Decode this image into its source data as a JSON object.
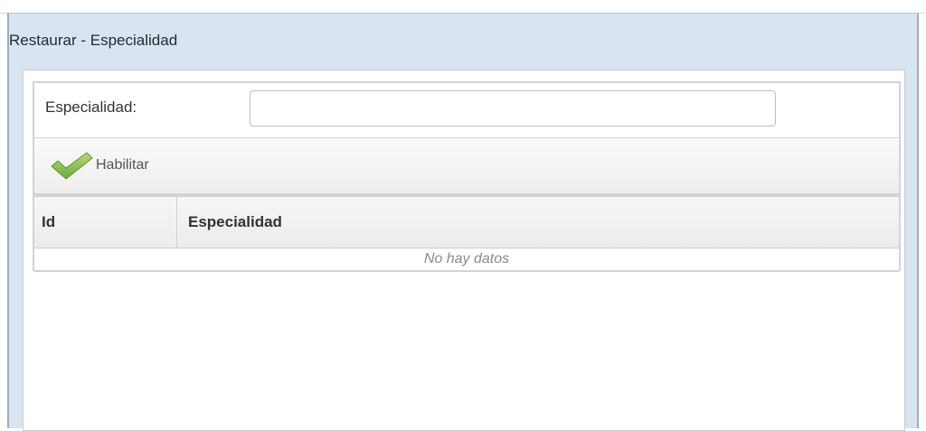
{
  "window": {
    "title": "Restaurar - Especialidad"
  },
  "form": {
    "label": "Especialidad:",
    "value": "",
    "placeholder": ""
  },
  "toolbar": {
    "habilitar_label": "Habilitar",
    "habilitar_icon": "checkmark-icon",
    "icon_color": "#8bc34a"
  },
  "grid": {
    "columns": [
      "Id",
      "Especialidad"
    ],
    "rows": [],
    "empty_text": "No hay datos"
  }
}
